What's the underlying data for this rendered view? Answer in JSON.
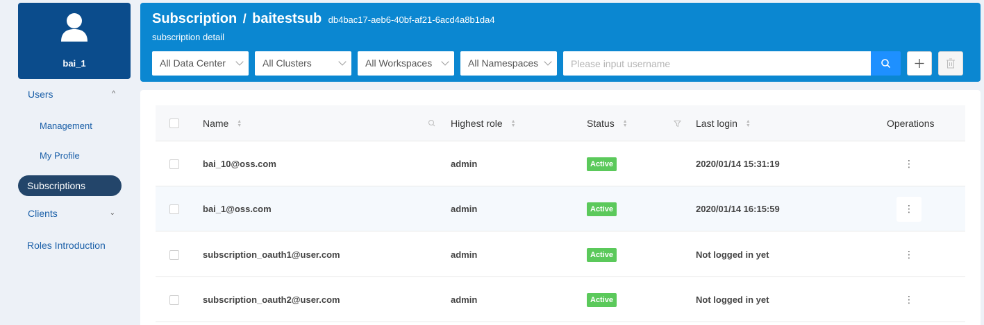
{
  "user": {
    "name": "bai_1"
  },
  "sidebar": {
    "items": [
      {
        "label": "Users",
        "chevron": "^"
      },
      {
        "label": "Management"
      },
      {
        "label": "My Profile"
      },
      {
        "label": "Subscriptions"
      },
      {
        "label": "Clients",
        "chevron": "⌄"
      },
      {
        "label": "Roles Introduction"
      }
    ]
  },
  "header": {
    "title": "Subscription",
    "separator": "/",
    "subscription_name": "baitestsub",
    "subscription_id": "db4bac17-aeb6-40bf-af21-6acd4a8b1da4",
    "subtitle": "subscription detail"
  },
  "filters": {
    "data_center": "All Data Center",
    "clusters": "All Clusters",
    "workspaces": "All Workspaces",
    "namespaces": "All Namespaces",
    "search_placeholder": "Please input username"
  },
  "table": {
    "columns": {
      "name": "Name",
      "highest_role": "Highest role",
      "status": "Status",
      "last_login": "Last login",
      "operations": "Operations"
    },
    "rows": [
      {
        "name": "bai_10@oss.com",
        "role": "admin",
        "status": "Active",
        "last_login": "2020/01/14 15:31:19",
        "ops": "⋮"
      },
      {
        "name": "bai_1@oss.com",
        "role": "admin",
        "status": "Active",
        "last_login": "2020/01/14 16:15:59",
        "ops": "⋮"
      },
      {
        "name": "subscription_oauth1@user.com",
        "role": "admin",
        "status": "Active",
        "last_login": "Not logged in yet",
        "ops": "⋮"
      },
      {
        "name": "subscription_oauth2@user.com",
        "role": "admin",
        "status": "Active",
        "last_login": "Not logged in yet",
        "ops": "⋮"
      }
    ]
  },
  "colors": {
    "header_bg": "#0b87d1",
    "user_card_bg": "#0b4c8c",
    "active_nav_bg": "#23456a",
    "status_active": "#5bc95b",
    "search_button": "#1e90ff"
  },
  "icons": {
    "avatar": "user-avatar-icon",
    "search": "search-icon",
    "add": "plus-icon",
    "delete": "trash-icon",
    "sort": "sort-icon",
    "filter": "filter-icon",
    "more": "more-vertical-icon"
  }
}
